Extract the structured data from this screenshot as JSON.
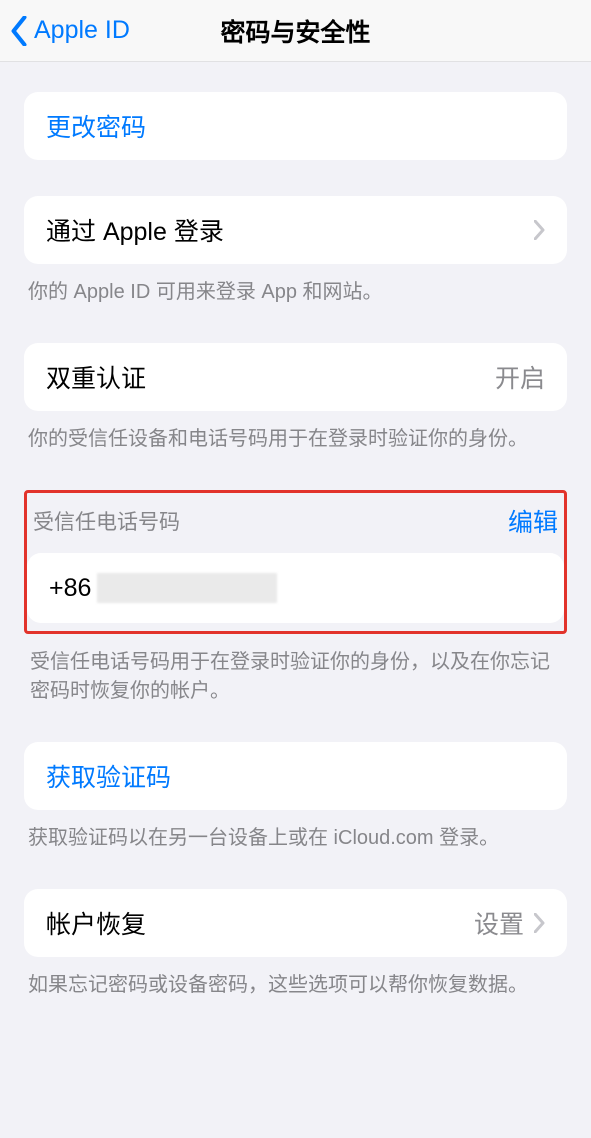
{
  "nav": {
    "back": "Apple ID",
    "title": "密码与安全性"
  },
  "change_password": "更改密码",
  "signin_with_apple": {
    "label": "通过 Apple 登录",
    "note": "你的 Apple ID 可用来登录 App 和网站。"
  },
  "two_factor": {
    "label": "双重认证",
    "value": "开启",
    "note": "你的受信任设备和电话号码用于在登录时验证你的身份。"
  },
  "trusted_phone": {
    "header": "受信任电话号码",
    "edit": "编辑",
    "prefix": "+86",
    "note": "受信任电话号码用于在登录时验证你的身份，以及在你忘记密码时恢复你的帐户。"
  },
  "get_code": {
    "label": "获取验证码",
    "note": "获取验证码以在另一台设备上或在 iCloud.com 登录。"
  },
  "account_recovery": {
    "label": "帐户恢复",
    "value": "设置",
    "note": "如果忘记密码或设备密码，这些选项可以帮你恢复数据。"
  }
}
